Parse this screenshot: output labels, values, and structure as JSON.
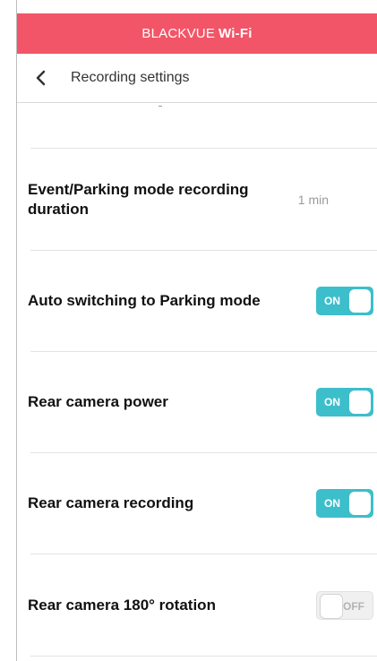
{
  "header": {
    "brand": "BLACKVUE",
    "wifi": "Wi-Fi",
    "bg_color": "#f25568"
  },
  "nav": {
    "title": "Recording settings"
  },
  "rows": [
    {
      "label": "Event/Parking mode recording duration",
      "value": "1 min"
    },
    {
      "label": "Auto switching to Parking mode",
      "toggle": "ON"
    },
    {
      "label": "Rear camera power",
      "toggle": "ON"
    },
    {
      "label": "Rear camera recording",
      "toggle": "ON"
    },
    {
      "label": "Rear camera 180° rotation",
      "toggle": "OFF"
    }
  ],
  "toggle_colors": {
    "on": "#3dbecb",
    "off": "#f0f0f0"
  }
}
